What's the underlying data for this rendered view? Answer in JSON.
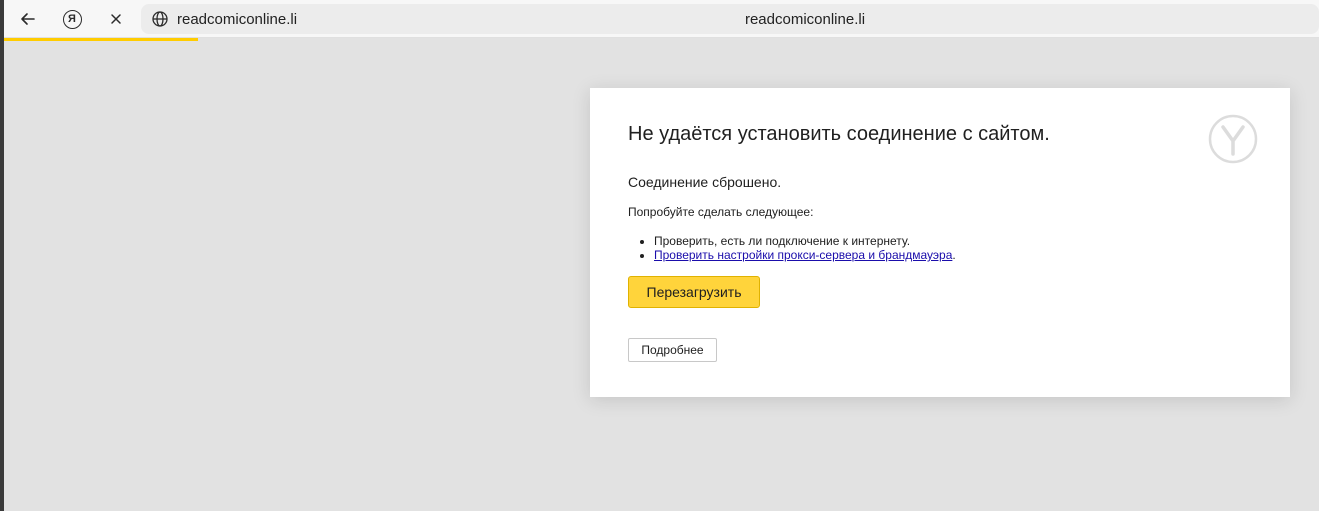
{
  "toolbar": {
    "back_icon": "arrow-left-icon",
    "yandex_icon": "yandex-logo-icon",
    "yandex_glyph": "Я",
    "close_icon": "close-icon"
  },
  "address_bar": {
    "url": "readcomiconline.li",
    "page_title": "readcomiconline.li",
    "globe_icon": "globe-icon"
  },
  "error_page": {
    "heading": "Не удаётся установить соединение с сайтом.",
    "subtext": "Соединение сброшено.",
    "try_label": "Попробуйте сделать следующее:",
    "suggestions": [
      "Проверить, есть ли подключение к интернету.",
      "Проверить настройки прокси-сервера и брандмауэра"
    ],
    "suggestion_period": ".",
    "reload_label": "Перезагрузить",
    "details_label": "Подробнее",
    "logo_icon": "yandex-browser-logo-icon"
  },
  "colors": {
    "accent": "#ffd43b",
    "progress": "#ffcc00",
    "link": "#1a0dab",
    "background": "#e2e2e2"
  }
}
